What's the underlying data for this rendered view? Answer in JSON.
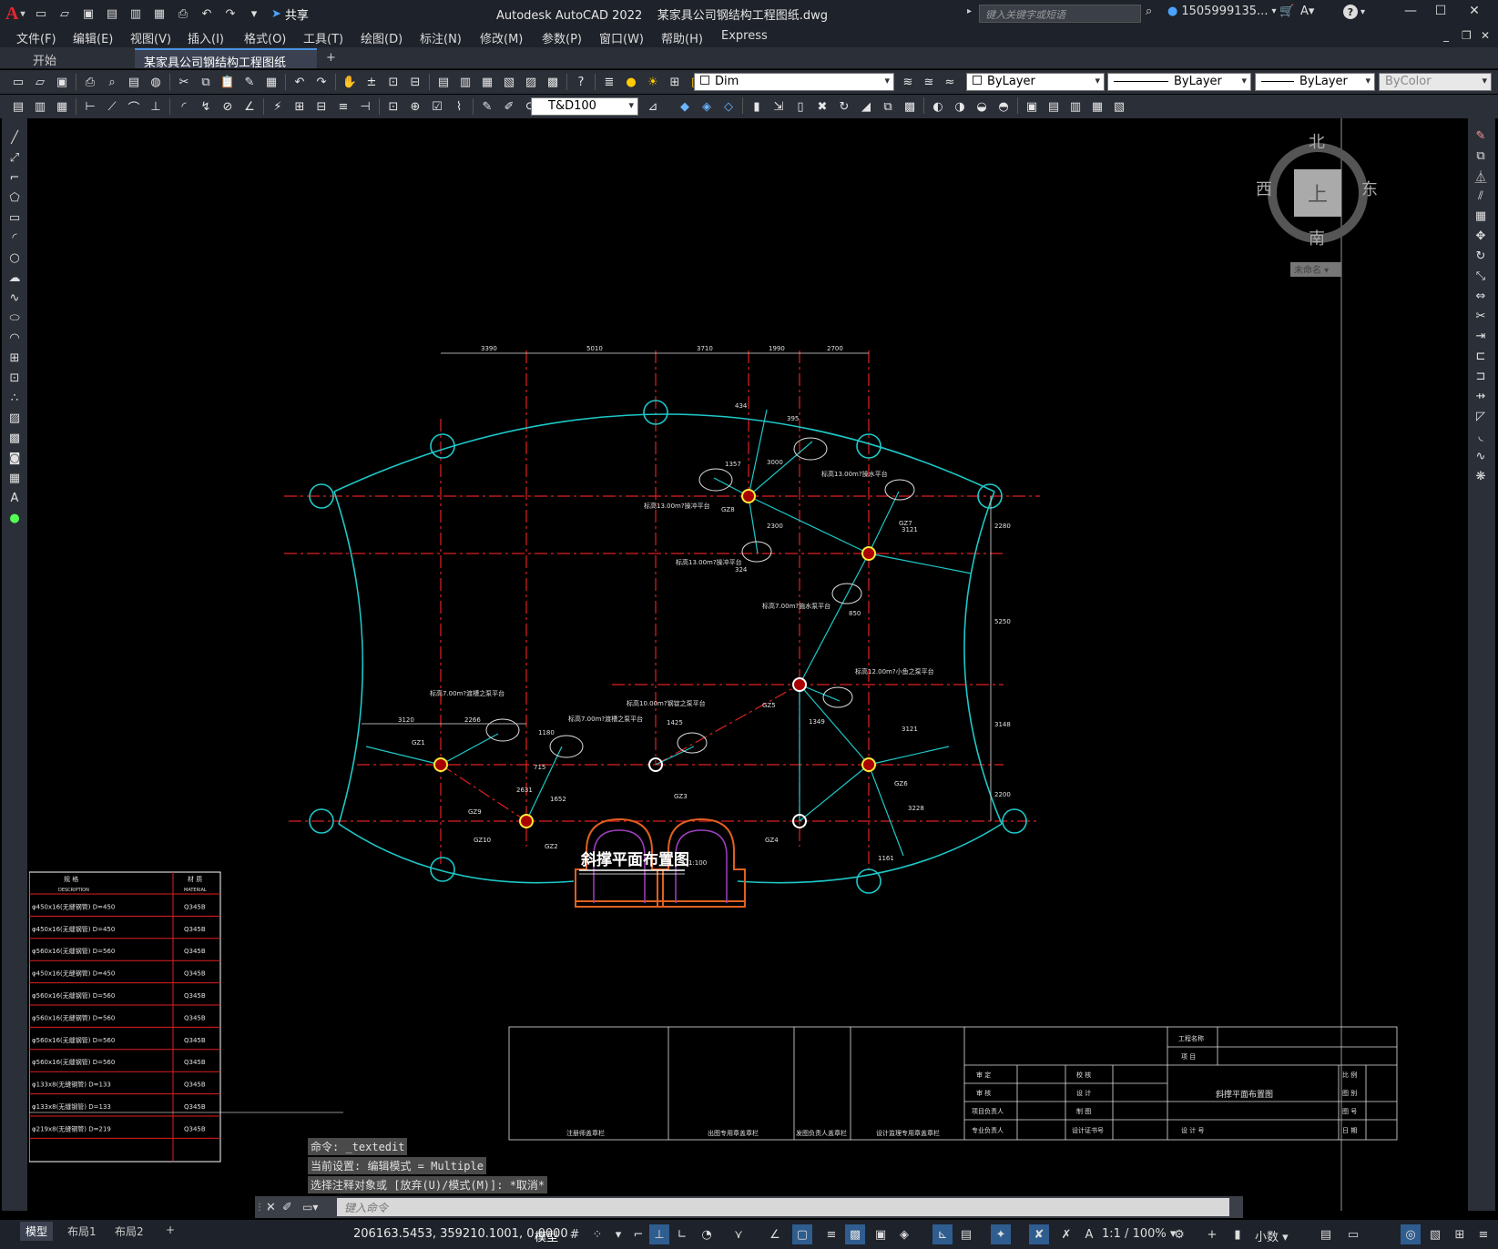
{
  "titlebar": {
    "app": "Autodesk AutoCAD 2022",
    "document": "某家具公司钢结构工程图纸.dwg",
    "share_label": "共享",
    "search_placeholder": "键入关键字或短语",
    "user": "1505999135...",
    "help": "?"
  },
  "menu": [
    "文件(F)",
    "编辑(E)",
    "视图(V)",
    "插入(I)",
    "格式(O)",
    "工具(T)",
    "绘图(D)",
    "标注(N)",
    "修改(M)",
    "参数(P)",
    "窗口(W)",
    "帮助(H)",
    "Express"
  ],
  "tabs": {
    "start": "开始",
    "drawing": "某家具公司钢结构工程图纸*",
    "add": "+"
  },
  "toolbar": {
    "layer_value": "Dim",
    "color_value": "ByLayer",
    "linetype_value": "ByLayer",
    "lineweight_value": "ByLayer",
    "plotstyle_value": "ByColor",
    "dimstyle_value": "T&D100"
  },
  "viewcube": {
    "north": "北",
    "south": "南",
    "east": "东",
    "west": "西",
    "top": "上",
    "ucs": "未命名"
  },
  "drawing": {
    "title": "斜撑平面布置图",
    "scale": "1:100",
    "dims_top": [
      "3390",
      "5010",
      "3710",
      "1990",
      "2700"
    ],
    "dims_right": [
      "2280",
      "5250",
      "3148",
      "2200"
    ],
    "labels": [
      "标高13.00m?操冲平台",
      "标高13.00m?操水平台",
      "标高13.00m?操冲平台",
      "标高7.00m?施水泵平台",
      "标高12.00m?小鱼之泵平台",
      "标高7.00m?渡槽之泵平台",
      "标高7.00m?渡槽之泵平台",
      "标高10.00m?钢锭之泵平台",
      "GZ1",
      "GZ2",
      "GZ3",
      "GZ4",
      "GZ5",
      "GZ6",
      "GZ7",
      "GZ8",
      "GZ9",
      "GZ10"
    ],
    "small_dims": [
      "434",
      "395",
      "1357",
      "3000",
      "2300",
      "324",
      "3121",
      "850",
      "1349",
      "3121",
      "1425",
      "3120",
      "2266",
      "1180",
      "715",
      "1652",
      "2631",
      "3228",
      "1161"
    ]
  },
  "material_table": {
    "header_spec": "规 格",
    "header_spec_en": "DESCRIPTION",
    "header_mat": "材 质",
    "header_mat_en": "MATERIAL",
    "rows": [
      {
        "spec": "φ450x16(无缝钢管) D=450",
        "mat": "Q345B"
      },
      {
        "spec": "φ450x16(无缝钢管) D=450",
        "mat": "Q345B"
      },
      {
        "spec": "φ560x16(无缝钢管) D=560",
        "mat": "Q345B"
      },
      {
        "spec": "φ450x16(无缝钢管) D=450",
        "mat": "Q345B"
      },
      {
        "spec": "φ560x16(无缝钢管) D=560",
        "mat": "Q345B"
      },
      {
        "spec": "φ560x16(无缝钢管) D=560",
        "mat": "Q345B"
      },
      {
        "spec": "φ560x16(无缝钢管) D=560",
        "mat": "Q345B"
      },
      {
        "spec": "φ560x16(无缝钢管) D=560",
        "mat": "Q345B"
      },
      {
        "spec": "φ133x8(无缝钢管) D=133",
        "mat": "Q345B"
      },
      {
        "spec": "φ133x8(无缝钢管) D=133",
        "mat": "Q345B"
      },
      {
        "spec": "φ219x8(无缝钢管) D=219",
        "mat": "Q345B"
      }
    ]
  },
  "title_block": {
    "project_name_label": "工程名称",
    "item_label": "项 目",
    "drawing_name": "斜撑平面布置图",
    "approve": "审 定",
    "check": "校 核",
    "review": "审 核",
    "design": "设 计",
    "project_lead": "项目负责人",
    "draw": "制 图",
    "discipline_lead": "专业负责人",
    "cert": "设计证书号",
    "design_no": "设 计 号",
    "scale_label": "比 例",
    "sheet_label": "图 别",
    "drawing_no": "图 号",
    "date": "日 期",
    "sign1": "注册师盖章栏",
    "sign2": "出图专用章盖章栏",
    "sign3": "发图负责人盖章栏",
    "sign4": "设计监理专用章盖章栏"
  },
  "command": {
    "history": [
      "命令: _textedit",
      "当前设置: 编辑模式 = Multiple",
      "选择注释对象或 [放弃(U)/模式(M)]: *取消*"
    ],
    "placeholder": "键入命令"
  },
  "layouts": [
    "模型",
    "布局1",
    "布局2",
    "+"
  ],
  "status": {
    "coords": "206163.5453, 359210.1001, 0.0000",
    "space": "模型",
    "scale": "1:1 / 100%",
    "units": "小数"
  }
}
